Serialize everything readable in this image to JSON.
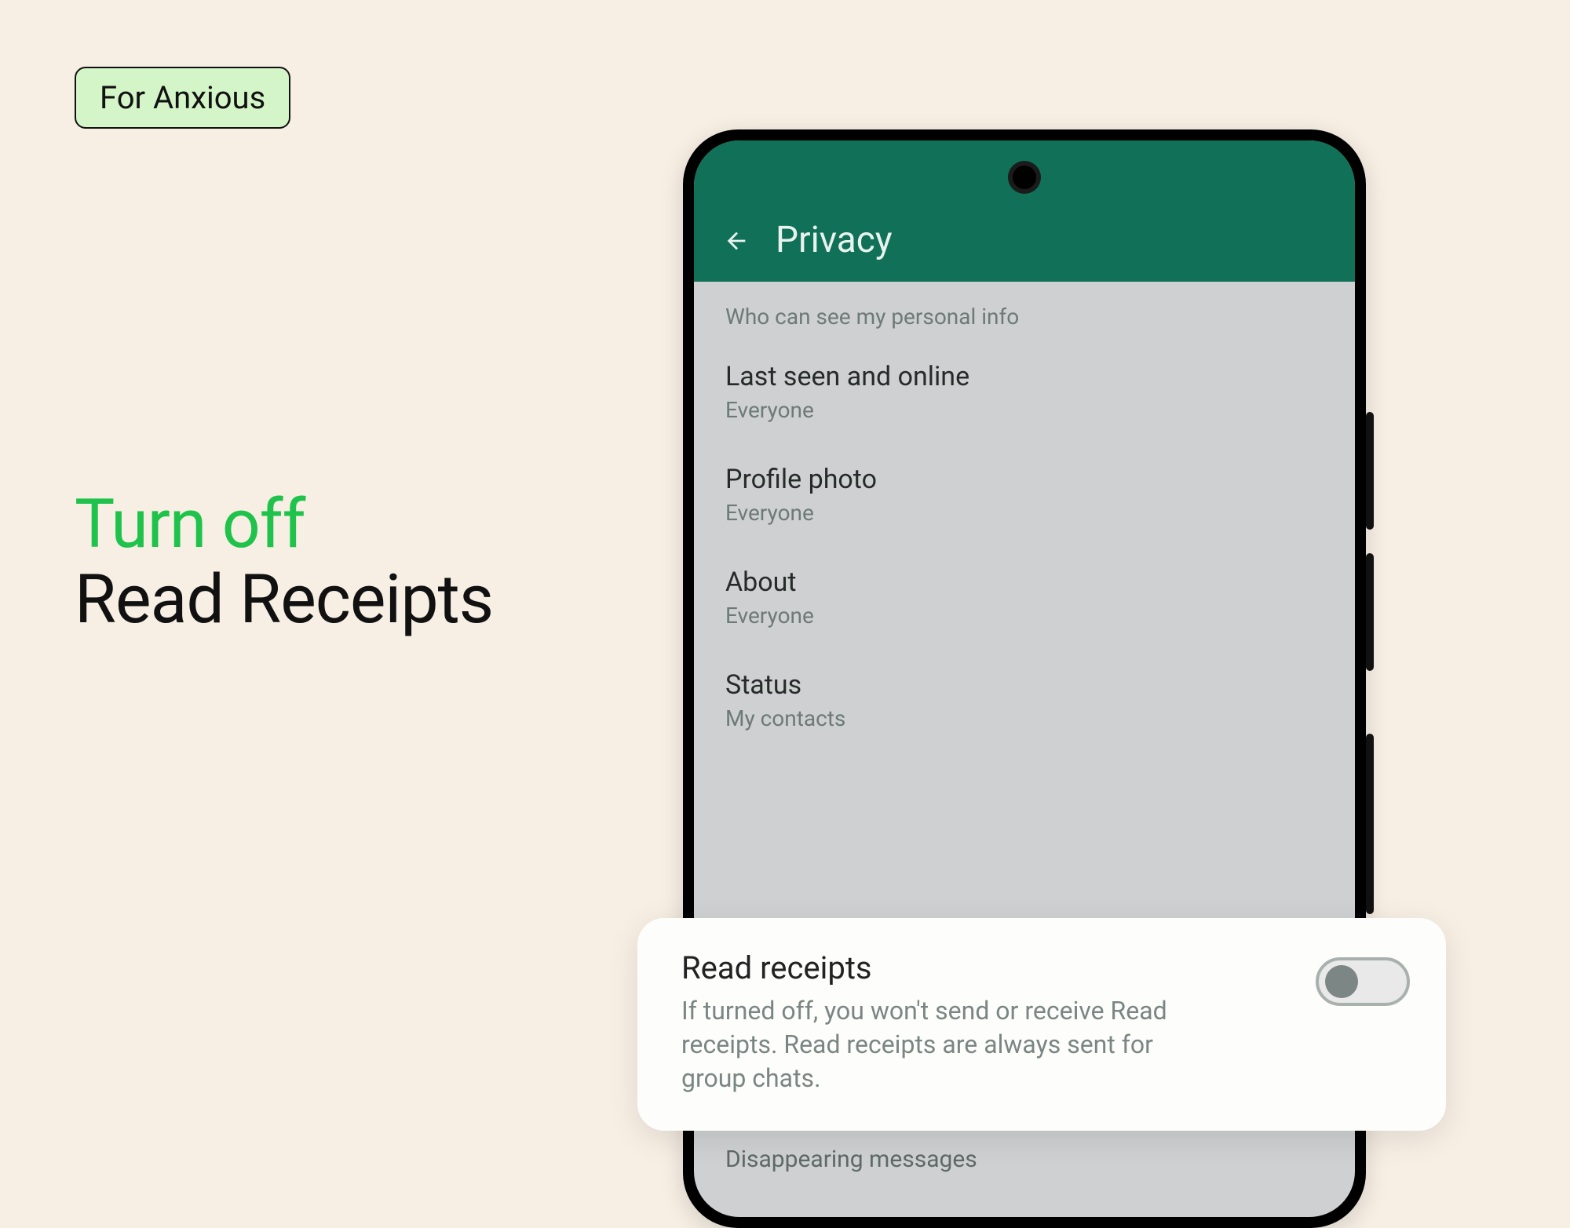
{
  "badge": {
    "label": "For Anxious"
  },
  "headline": {
    "line1": "Turn off",
    "line2": "Read Receipts"
  },
  "phone": {
    "appbar": {
      "title": "Privacy"
    },
    "section_header": "Who can see my personal info",
    "settings": [
      {
        "title": "Last seen and online",
        "value": "Everyone"
      },
      {
        "title": "Profile photo",
        "value": "Everyone"
      },
      {
        "title": "About",
        "value": "Everyone"
      },
      {
        "title": "Status",
        "value": "My contacts"
      }
    ],
    "peek_row": {
      "title": "Disappearing messages"
    }
  },
  "callout": {
    "title": "Read receipts",
    "description": "If turned off, you won't send or receive Read receipts. Read receipts are always sent for group chats.",
    "toggle_on": false
  },
  "colors": {
    "accent_green": "#1fc24a",
    "appbar_green": "#107158",
    "badge_bg": "#d3f5c8",
    "page_bg": "#f7efe4"
  }
}
